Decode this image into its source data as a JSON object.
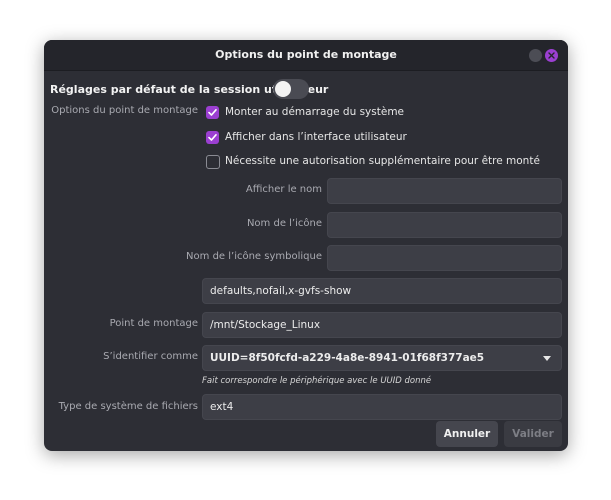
{
  "window": {
    "title": "Options du point de montage"
  },
  "session_defaults": {
    "label": "Réglages par défaut de la session utilisateur",
    "enabled": false
  },
  "mount_options": {
    "label": "Options du point de montage",
    "checkboxes": [
      {
        "label": "Monter au démarrage du système",
        "checked": true
      },
      {
        "label": "Afficher dans l’interface utilisateur",
        "checked": true
      },
      {
        "label": "Nécessite une autorisation supplémentaire pour être monté",
        "checked": false
      }
    ]
  },
  "fields": {
    "display_name": {
      "label": "Afficher le nom",
      "value": ""
    },
    "icon_name": {
      "label": "Nom de l’icône",
      "value": ""
    },
    "symbolic_icon_name": {
      "label": "Nom de l’icône symbolique",
      "value": ""
    },
    "options": {
      "value": "defaults,nofail,x-gvfs-show"
    },
    "mount_point": {
      "label": "Point de montage",
      "value": "/mnt/Stockage_Linux"
    },
    "identify_as": {
      "label": "S’identifier comme",
      "value": "UUID=8f50fcfd-a229-4a8e-8941-01f68f377ae5"
    },
    "identify_hint": "Fait correspondre le périphérique avec le UUID donné",
    "fs_type": {
      "label": "Type de système de fichiers",
      "value": "ext4"
    }
  },
  "buttons": {
    "cancel": "Annuler",
    "ok": "Valider"
  },
  "colors": {
    "accent": "#9b3fd1",
    "dialog_bg": "#2d2e35",
    "field_bg": "#3d3e46"
  }
}
